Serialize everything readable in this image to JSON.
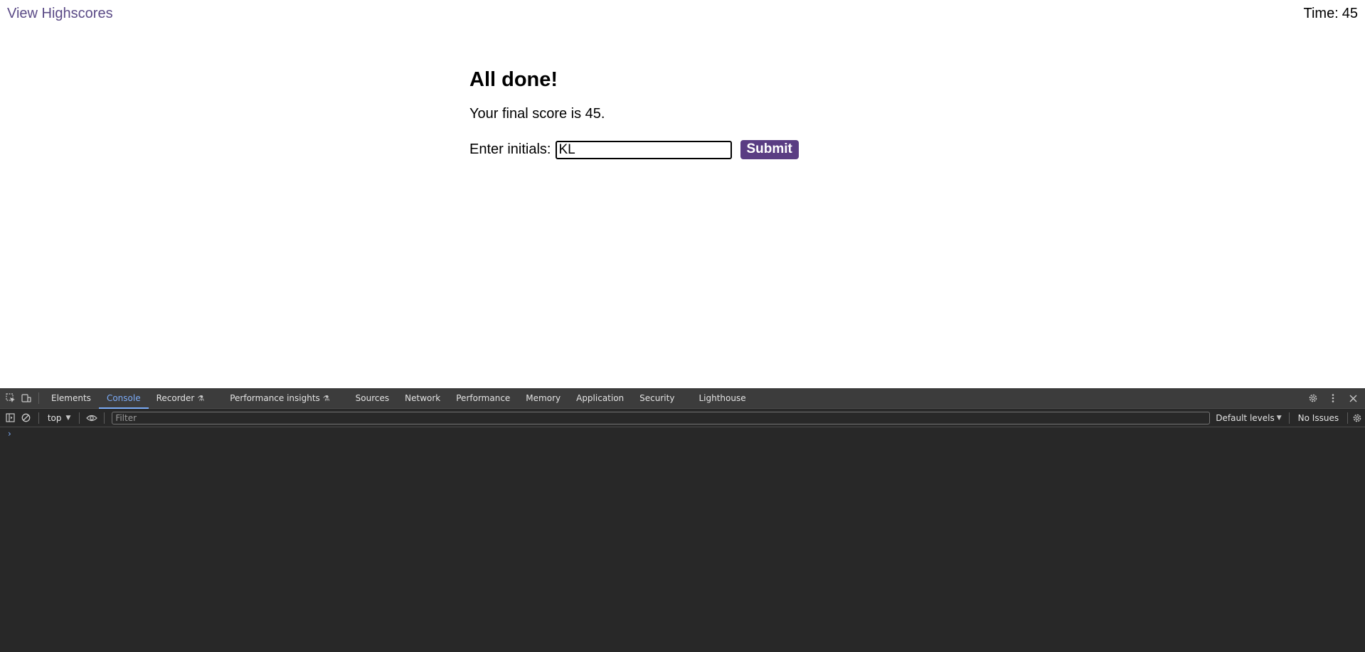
{
  "page": {
    "highscores_link": "View Highscores",
    "timer_label": "Time:",
    "timer_value": "45",
    "heading": "All done!",
    "final_score_text": "Your final score is 45.",
    "initials_label": "Enter initials:",
    "initials_value": "KL",
    "submit_label": "Submit"
  },
  "devtools": {
    "tabs": [
      {
        "label": "Elements",
        "active": false
      },
      {
        "label": "Console",
        "active": true
      },
      {
        "label": "Recorder",
        "active": false,
        "experimental": true
      },
      {
        "label": "Performance insights",
        "active": false,
        "experimental": true
      },
      {
        "label": "Sources",
        "active": false
      },
      {
        "label": "Network",
        "active": false
      },
      {
        "label": "Performance",
        "active": false
      },
      {
        "label": "Memory",
        "active": false
      },
      {
        "label": "Application",
        "active": false
      },
      {
        "label": "Security",
        "active": false
      },
      {
        "label": "Lighthouse",
        "active": false
      }
    ],
    "context": "top",
    "filter_placeholder": "Filter",
    "levels": "Default levels",
    "issues": "No Issues",
    "prompt": "›"
  },
  "colors": {
    "link": "#5a4a86",
    "submit_bg": "#5a3d83",
    "devtools_bg": "#282828",
    "devtools_tabbar": "#3c3c3c",
    "active_tab": "#7cacf8"
  },
  "icons": [
    "inspect-icon",
    "device-toggle-icon",
    "flask-icon",
    "settings-gear-icon",
    "kebab-menu-icon",
    "close-icon",
    "sidebar-toggle-icon",
    "clear-console-icon",
    "eye-icon",
    "console-settings-icon"
  ]
}
